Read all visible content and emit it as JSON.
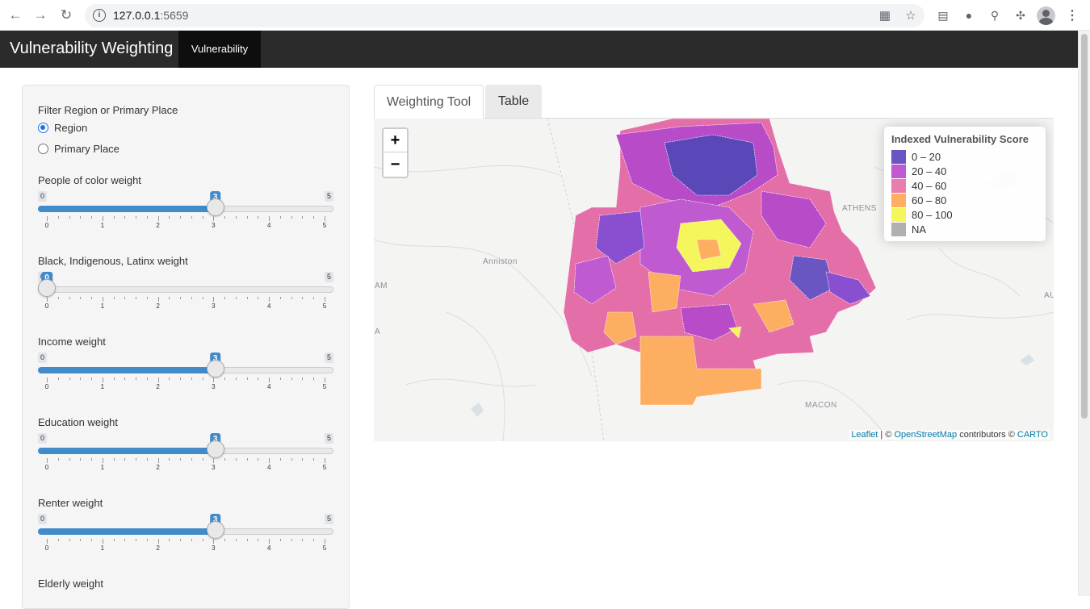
{
  "browser": {
    "url_host": "127.0.0.1",
    "url_port": ":5659"
  },
  "navbar": {
    "brand": "Vulnerability Weighting",
    "tabs": [
      {
        "label": "Vulnerability"
      }
    ]
  },
  "sidebar": {
    "filter_label": "Filter Region or Primary Place",
    "radio_options": [
      {
        "label": "Region",
        "checked": true
      },
      {
        "label": "Primary Place",
        "checked": false
      }
    ],
    "sliders": [
      {
        "label": "People of color weight",
        "min": "0",
        "max": "5",
        "value": "3",
        "fraction": 0.6
      },
      {
        "label": "Black, Indigenous, Latinx weight",
        "min": "0",
        "max": "5",
        "value": "0",
        "fraction": 0.0
      },
      {
        "label": "Income weight",
        "min": "0",
        "max": "5",
        "value": "3",
        "fraction": 0.6
      },
      {
        "label": "Education weight",
        "min": "0",
        "max": "5",
        "value": "3",
        "fraction": 0.6
      },
      {
        "label": "Renter weight",
        "min": "0",
        "max": "5",
        "value": "3",
        "fraction": 0.6
      }
    ],
    "tick_labels": [
      "0",
      "1",
      "2",
      "3",
      "4",
      "5"
    ],
    "next_label": "Elderly weight"
  },
  "main": {
    "tabs": [
      {
        "label": "Weighting Tool",
        "active": true
      },
      {
        "label": "Table",
        "active": false
      }
    ],
    "map": {
      "zoom_in": "+",
      "zoom_out": "−",
      "legend_title": "Indexed Vulnerability Score",
      "legend": [
        {
          "label": "0 – 20",
          "color": "#6a55c2"
        },
        {
          "label": "20 – 40",
          "color": "#c05ad0"
        },
        {
          "label": "40 – 60",
          "color": "#e87eac"
        },
        {
          "label": "60 – 80",
          "color": "#fdae61"
        },
        {
          "label": "80 – 100",
          "color": "#f4f65b"
        },
        {
          "label": "NA",
          "color": "#b0b0b0"
        }
      ],
      "place_labels": [
        "ATHENS",
        "Anniston",
        "AM",
        "A",
        "MACON",
        "AU"
      ],
      "attribution": {
        "leaflet": "Leaflet",
        "sep": " | © ",
        "osm": "OpenStreetMap",
        "contrib": " contributors © ",
        "carto": "CARTO"
      }
    }
  }
}
